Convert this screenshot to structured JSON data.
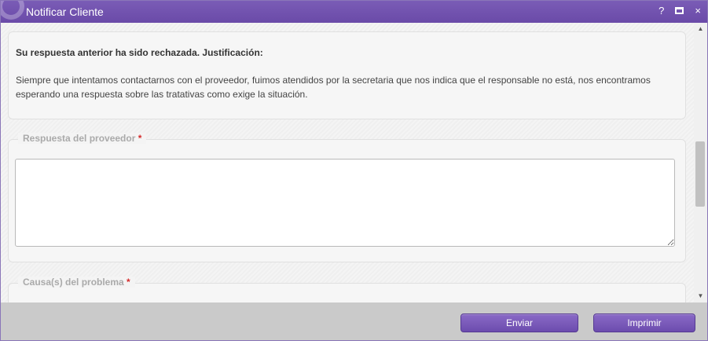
{
  "window": {
    "title": "Notificar Cliente",
    "controls": {
      "help": "?",
      "maximize_icon": "maximize-icon",
      "close": "×"
    }
  },
  "justification": {
    "heading": "Su respuesta anterior ha sido rechazada. Justificación:",
    "body": "Siempre que intentamos contactarnos con el proveedor, fuimos atendidos por la secretaria que nos indica que el responsable no está, nos encontramos esperando una respuesta sobre las tratativas como exige la situación."
  },
  "fields": {
    "respuesta": {
      "label": "Respuesta del proveedor",
      "required_mark": "*",
      "value": ""
    },
    "causa": {
      "label": "Causa(s) del problema",
      "required_mark": "*"
    }
  },
  "footer": {
    "enviar": "Enviar",
    "imprimir": "Imprimir"
  },
  "colors": {
    "accent": "#6a4aa8",
    "required": "#d42b2b"
  }
}
